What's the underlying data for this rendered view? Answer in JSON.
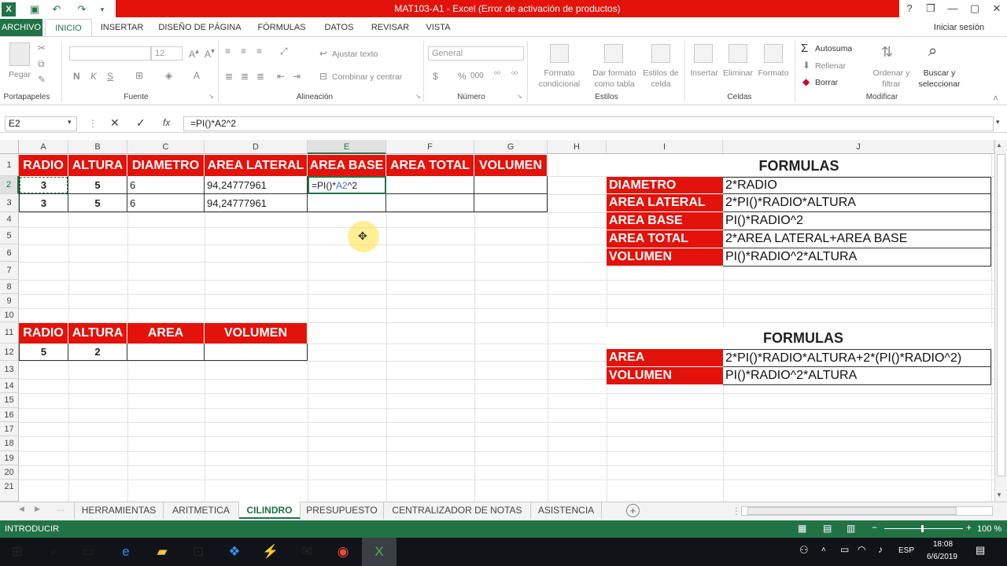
{
  "window": {
    "title": "MAT103-A1 -  Excel (Error de activación de productos)",
    "help_icon": "?",
    "restore_icon": "❐",
    "minimize_icon": "—",
    "maximize_icon": "▢",
    "close_icon": "✕"
  },
  "ribbon_tabs": [
    "ARCHIVO",
    "INICIO",
    "INSERTAR",
    "DISEÑO DE PÁGINA",
    "FÓRMULAS",
    "DATOS",
    "REVISAR",
    "VISTA"
  ],
  "signin": "Iniciar sesión",
  "ribbon": {
    "pegar": "Pegar",
    "portapapeles": "Portapapeles",
    "font_size": "12",
    "fuente": "Fuente",
    "bold": "N",
    "italic": "K",
    "underline": "S",
    "ajustar": "Ajustar texto",
    "combinar": "Combinar y centrar",
    "alineacion": "Alineación",
    "number_format": "General",
    "percent": "%",
    "thousands": "000",
    "currency": "$",
    "numero": "Número",
    "formato_condicional": [
      "Formato",
      "condicional"
    ],
    "dar_formato": [
      "Dar formato",
      "como tabla"
    ],
    "estilos_celda": [
      "Estilos de",
      "celda"
    ],
    "estilos": "Estilos",
    "insertar": "Insertar",
    "eliminar": "Eliminar",
    "formato": "Formato",
    "celdas": "Celdas",
    "autosuma": "Autosuma",
    "rellenar": "Rellenar",
    "borrar": "Borrar",
    "ordenar": [
      "Ordenar y",
      "filtrar"
    ],
    "buscar": [
      "Buscar y",
      "seleccionar"
    ],
    "modificar": "Modificar"
  },
  "formula_bar": {
    "name_box": "E2",
    "cancel": "✕",
    "enter": "✓",
    "fx": "fx",
    "formula": "=PI()*A2^2"
  },
  "columns": [
    "A",
    "B",
    "C",
    "D",
    "E",
    "F",
    "G",
    "H",
    "I",
    "J"
  ],
  "rows": [
    "1",
    "2",
    "3",
    "4",
    "5",
    "6",
    "7",
    "8",
    "9",
    "10",
    "11",
    "12",
    "13",
    "14",
    "15",
    "16",
    "17",
    "18",
    "19",
    "20",
    "21"
  ],
  "table1": {
    "headers": [
      "RADIO",
      "ALTURA",
      "DIAMETRO",
      "AREA LATERAL",
      "AREA BASE",
      "AREA TOTAL",
      "VOLUMEN"
    ],
    "row2": [
      "3",
      "5",
      "6",
      "94,24777961"
    ],
    "row3": [
      "3",
      "5",
      "6",
      "94,24777961"
    ],
    "edit_prefix": "=PI()*",
    "edit_ref": "A2",
    "edit_suffix": "^2"
  },
  "table2": {
    "headers": [
      "RADIO",
      "ALTURA",
      "AREA",
      "VOLUMEN"
    ],
    "row12": [
      "5",
      "2"
    ]
  },
  "formulas1": {
    "title": "FORMULAS",
    "rows": [
      [
        "DIAMETRO",
        "2*RADIO"
      ],
      [
        "AREA LATERAL",
        "2*PI()*RADIO*ALTURA"
      ],
      [
        "AREA BASE",
        "PI()*RADIO^2"
      ],
      [
        "AREA TOTAL",
        "2*AREA LATERAL+AREA BASE"
      ],
      [
        "VOLUMEN",
        "PI()*RADIO^2*ALTURA"
      ]
    ]
  },
  "formulas2": {
    "title": "FORMULAS",
    "rows": [
      [
        "AREA",
        "2*PI()*RADIO*ALTURA+2*(PI()*RADIO^2)"
      ],
      [
        "VOLUMEN",
        "PI()*RADIO^2*ALTURA"
      ]
    ]
  },
  "sheet_tabs": [
    "HERRAMIENTAS",
    "ARITMETICA",
    "CILINDRO",
    "PRESUPUESTO",
    "CENTRALIZADOR DE NOTAS",
    "ASISTENCIA"
  ],
  "status": {
    "mode": "INTRODUCIR",
    "zoom": "100 %"
  },
  "taskbar": {
    "lang": "ESP",
    "time": "18:08",
    "date": "6/6/2019"
  }
}
